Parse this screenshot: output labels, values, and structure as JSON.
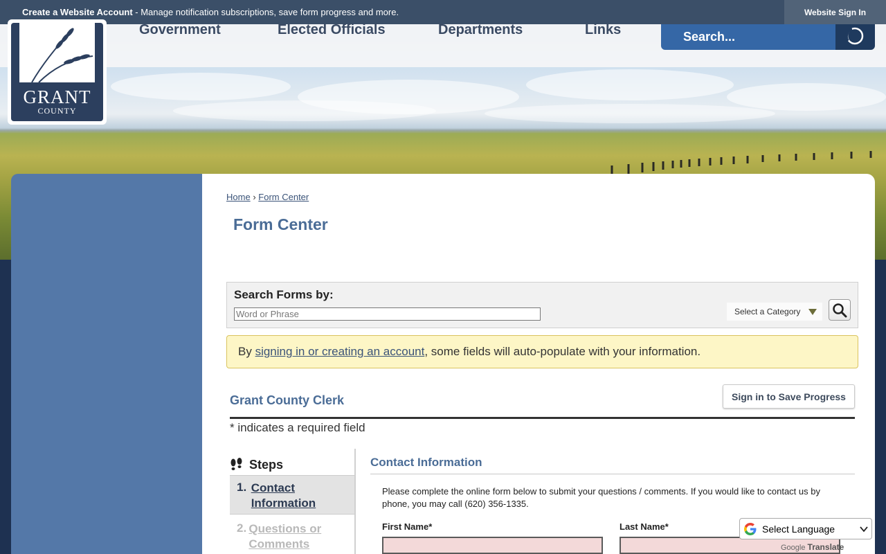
{
  "topbar": {
    "account_link": "Create a Website Account",
    "account_msg": " - Manage notification subscriptions, save form progress and more.",
    "signin": "Website Sign In"
  },
  "nav": {
    "items": [
      "Government",
      "Elected Officials",
      "Departments",
      "Links"
    ],
    "search_placeholder": "Search..."
  },
  "logo": {
    "line1": "GRANT",
    "line2": "COUNTY"
  },
  "breadcrumb": {
    "home": "Home",
    "sep": "›",
    "current": "Form Center"
  },
  "page_title": "Form Center",
  "search_forms": {
    "label": "Search Forms by:",
    "placeholder": "Word or Phrase",
    "category": "Select a Category"
  },
  "notice": {
    "prefix": "By ",
    "link": "signing in or creating an account",
    "suffix": ", some fields will auto-populate with your information."
  },
  "form": {
    "title": "Grant County Clerk",
    "save_button": "Sign in to Save Progress",
    "required_note": "* indicates a required field"
  },
  "steps": {
    "heading": "Steps",
    "items": [
      {
        "num": "1.",
        "label": "Contact Information"
      },
      {
        "num": "2.",
        "label": "Questions or Comments"
      }
    ]
  },
  "section": {
    "title": "Contact Information",
    "instructions": "Please complete the online form below to submit your questions / comments. If you would like to contact us by phone, you may call (620) 356-1335.",
    "first_name": "First Name*",
    "last_name": "Last Name*"
  },
  "translate": {
    "select": "Select Language",
    "credit_google": "Google",
    "credit_translate": "Translate"
  },
  "colors": {
    "topbar": "#3b4f68",
    "nav_text": "#3a4a63",
    "search_blue": "#3567a6",
    "sidebar": "#5478a8",
    "heading_blue": "#4a6c96",
    "notice_bg": "#fdf6c6",
    "required_input_bg": "#f3d9d9"
  },
  "icons": [
    "search-icon",
    "wheat-icon",
    "footsteps-icon",
    "google-g-icon",
    "chevron-down-icon"
  ]
}
